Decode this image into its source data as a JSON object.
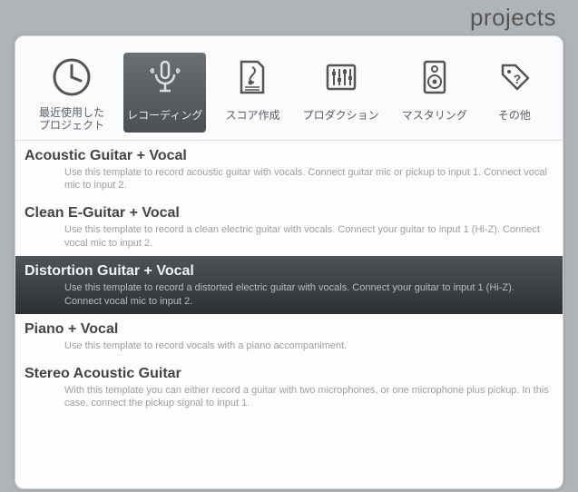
{
  "header": {
    "title": "projects"
  },
  "tabs": [
    {
      "key": "recent",
      "label": "最近使用した\nプロジェクト"
    },
    {
      "key": "recording",
      "label": "レコーディング"
    },
    {
      "key": "score",
      "label": "スコア作成"
    },
    {
      "key": "production",
      "label": "プロダクション"
    },
    {
      "key": "mastering",
      "label": "マスタリング"
    },
    {
      "key": "other",
      "label": "その他"
    }
  ],
  "selected_tab": "recording",
  "templates": [
    {
      "title": "Acoustic Guitar + Vocal",
      "desc": "Use this template to record acoustic guitar with vocals. Connect guitar mic or pickup to input 1. Connect vocal mic to input 2."
    },
    {
      "title": "Clean E-Guitar + Vocal",
      "desc": "Use this template to record a clean electric guitar with vocals. Connect your guitar to input 1 (Hi-Z). Connect vocal mic to input 2."
    },
    {
      "title": "Distortion Guitar + Vocal",
      "desc": "Use this template to record a distorted electric guitar with vocals. Connect your guitar to input 1 (Hi-Z). Connect vocal mic to input 2."
    },
    {
      "title": "Piano + Vocal",
      "desc": "Use this template to record vocals with a piano accompaniment."
    },
    {
      "title": "Stereo Acoustic Guitar",
      "desc": "With this template you can either record a guitar with two microphones, or one microphone plus pickup. In this case, connect the pickup signal to input 1."
    }
  ],
  "selected_template_index": 2
}
